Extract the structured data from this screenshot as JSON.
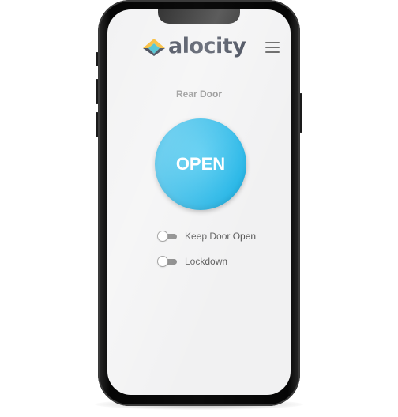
{
  "app": {
    "brand": "alocity",
    "logo_icon": "alocity-logo-icon",
    "menu_icon": "hamburger-menu-icon"
  },
  "door": {
    "name": "Rear Door",
    "action_label": "OPEN",
    "action_color": "#1bb3e6"
  },
  "toggles": [
    {
      "label": "Keep Door Open",
      "state": "off"
    },
    {
      "label": "Lockdown",
      "state": "off"
    }
  ],
  "colors": {
    "accent": "#1bb3e6",
    "logo_yellow": "#f7b21a",
    "logo_teal": "#2bb7c9",
    "logo_navy": "#232a3b",
    "screen_bg": "#f1f1f2"
  }
}
